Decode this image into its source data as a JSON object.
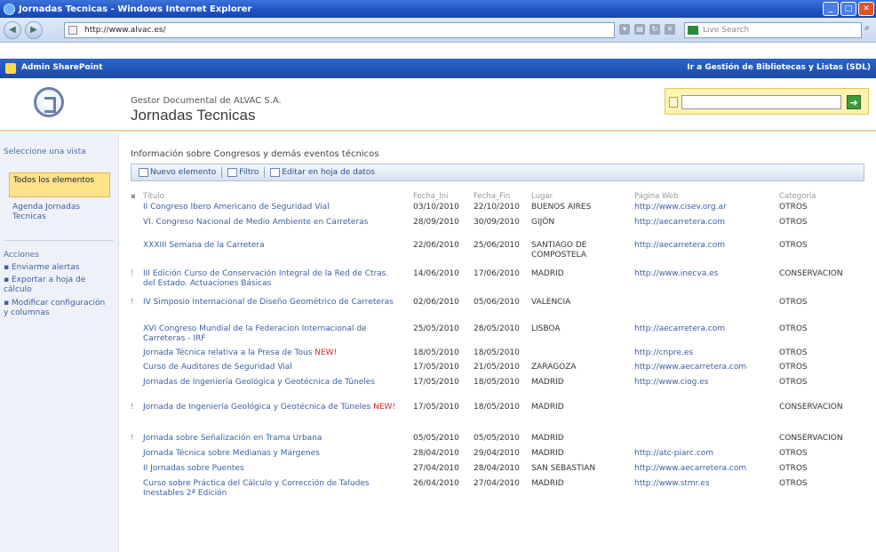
{
  "browser": {
    "window_title": "Jornadas Tecnicas - Windows Internet Explorer",
    "url": "http://www.alvac.es/",
    "search_placeholder": "Live Search"
  },
  "sharepoint": {
    "site_link": "Admin SharePoint",
    "goto_link": "Ir a Gestión de Bibliotecas y Listas (SDL)"
  },
  "header": {
    "breadcrumb": "Gestor Documental de ALVAC S.A.",
    "title": "Jornadas Tecnicas"
  },
  "leftnav": {
    "view_heading": "Seleccione una vista",
    "views": [
      "Todos los elementos",
      "Agenda Jornadas Tecnicas"
    ],
    "actions_heading": "Acciones",
    "actions": [
      "Enviarme alertas",
      "Exportar a hoja de cálculo",
      "Modificar configuración y columnas"
    ]
  },
  "main": {
    "description": "Información sobre Congresos y demás eventos técnicos",
    "toolbar": {
      "new_label": "Nuevo elemento",
      "filter_label": "Filtro",
      "edit_sheet_label": "Editar en hoja de datos"
    },
    "columns": {
      "title": "Título",
      "fecha_ini": "Fecha_Ini",
      "fecha_fin": "Fecha_Fin",
      "lugar": "Lugar",
      "web": "Página Web",
      "categoria": "Categoría"
    },
    "rows": [
      {
        "title": "II Congreso Ibero Americano de Seguridad Vial",
        "fi": "03/10/2010",
        "ff": "22/10/2010",
        "lugar": "BUENOS AIRES",
        "web": "http://www.cisev.org.ar",
        "cat": "OTROS",
        "mark": "",
        "new": ""
      },
      {
        "title": "VI. Congreso Nacional de Medio Ambiente en Carreteras",
        "fi": "28/09/2010",
        "ff": "30/09/2010",
        "lugar": "GIJÓN",
        "web": "http://aecarretera.com",
        "cat": "OTROS",
        "mark": "",
        "new": ""
      },
      {
        "title": "XXXIII Semana de la Carretera",
        "fi": "22/06/2010",
        "ff": "25/06/2010",
        "lugar": "SANTIAGO DE COMPOSTELA",
        "web": "http://aecarretera.com",
        "cat": "OTROS",
        "mark": "",
        "new": ""
      },
      {
        "title": "III Edición Curso de Conservación Integral de la Red de Ctras. del Estado. Actuaciones Básicas",
        "fi": "14/06/2010",
        "ff": "17/06/2010",
        "lugar": "MADRID",
        "web": "http://www.inecva.es",
        "cat": "CONSERVACION",
        "mark": "!",
        "new": ""
      },
      {
        "title": "IV Simposio Internacional de Diseño Geométrico de Carreteras",
        "fi": "02/06/2010",
        "ff": "05/06/2010",
        "lugar": "VALENCIA",
        "web": "",
        "cat": "OTROS",
        "mark": "!",
        "new": ""
      },
      {
        "title": "XVI Congreso Mundial de la Federacion Internacional de Carreteras - IRF",
        "fi": "25/05/2010",
        "ff": "28/05/2010",
        "lugar": "LISBOA",
        "web": "http://aecarretera.com",
        "cat": "OTROS",
        "mark": "",
        "new": ""
      },
      {
        "title": "Jornada Técnica relativa a la Presa de Tous",
        "fi": "18/05/2010",
        "ff": "18/05/2010",
        "lugar": "",
        "web": "http://cnpre.es",
        "cat": "OTROS",
        "mark": "",
        "new": "NEW!"
      },
      {
        "title": "Curso de Auditores de Seguridad Vial",
        "fi": "17/05/2010",
        "ff": "21/05/2010",
        "lugar": "ZARAGOZA",
        "web": "http://www.aecarretera.com",
        "cat": "OTROS",
        "mark": "",
        "new": ""
      },
      {
        "title": "Jornadas de Ingeniería Geológica y Geotécnica de Túneles",
        "fi": "17/05/2010",
        "ff": "18/05/2010",
        "lugar": "MADRID",
        "web": "http://www.ciog.es",
        "cat": "OTROS",
        "mark": "",
        "new": ""
      },
      {
        "title": "Jornada de Ingeniería Geológica y Geotécnica de Túneles",
        "fi": "17/05/2010",
        "ff": "18/05/2010",
        "lugar": "MADRID",
        "web": "",
        "cat": "CONSERVACION",
        "mark": "!",
        "new": "NEW!"
      },
      {
        "title": "Jornada sobre Señalización en Trama Urbana",
        "fi": "05/05/2010",
        "ff": "05/05/2010",
        "lugar": "MADRID",
        "web": "",
        "cat": "CONSERVACION",
        "mark": "!",
        "new": ""
      },
      {
        "title": "Jornada Técnica sobre Medianas y Márgenes",
        "fi": "28/04/2010",
        "ff": "29/04/2010",
        "lugar": "MADRID",
        "web": "http://atc-piarc.com",
        "cat": "OTROS",
        "mark": "",
        "new": ""
      },
      {
        "title": "II Jornadas sobre Puentes",
        "fi": "27/04/2010",
        "ff": "28/04/2010",
        "lugar": "SAN SEBASTIAN",
        "web": "http://www.aecarretera.com",
        "cat": "OTROS",
        "mark": "",
        "new": ""
      },
      {
        "title": "Curso sobre Práctica del Cálculo y Corrección de Taludes Inestables 2ª Edición",
        "fi": "26/04/2010",
        "ff": "27/04/2010",
        "lugar": "MADRID",
        "web": "http://www.stmr.es",
        "cat": "OTROS",
        "mark": "",
        "new": ""
      }
    ]
  }
}
